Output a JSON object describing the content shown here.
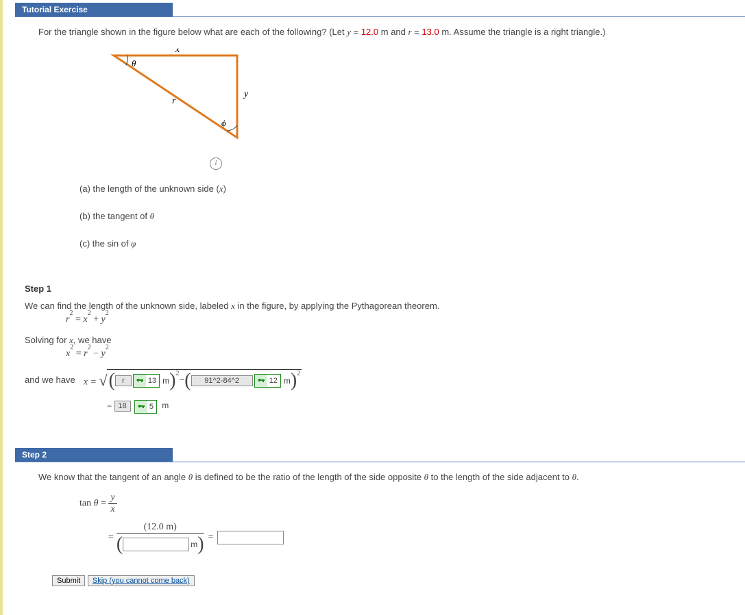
{
  "tutorial": {
    "header": "Tutorial Exercise",
    "prompt_prefix": "For the triangle shown in the figure below what are each of the following? (Let ",
    "prompt_y_var": "y",
    "prompt_y_eq": " = ",
    "prompt_y_val": "12.0",
    "prompt_y_unit": " m and ",
    "prompt_r_var": "r",
    "prompt_r_eq": " = ",
    "prompt_r_val": "13.0",
    "prompt_r_unit": " m. Assume the triangle is a right triangle.)",
    "fig": {
      "x": "x",
      "y": "y",
      "r": "r",
      "theta": "θ",
      "phi": "ϕ"
    },
    "info_icon": "info-icon",
    "parts": {
      "a": "(a) the length of the unknown side (",
      "a_var": "x",
      "a_end": ")",
      "b": "(b) the tangent of ",
      "b_var": "θ",
      "c": "(c) the sin of ",
      "c_var": "φ"
    }
  },
  "step1": {
    "title": "Step 1",
    "line1_pre": "We can find the length of the unknown side, labeled ",
    "line1_var": "x",
    "line1_post": " in the figure, by applying the Pythagorean theorem.",
    "eq1_lhs": "r",
    "eq1_sup": "2",
    "eq1_mid": " = ",
    "eq1_x": "x",
    "eq1_plus": " + ",
    "eq1_y": "y",
    "line2_pre": "Solving for ",
    "line2_var": "x",
    "line2_post": ", we have",
    "eq2_x": "x",
    "eq2_eq": " = ",
    "eq2_r": "r",
    "eq2_minus": " − ",
    "eq2_y": "y",
    "line3": "and we have",
    "x_eq": "x = ",
    "box1_wrong": "r",
    "box1_correct": "13",
    "m": "m",
    "minus": " − ",
    "box2_wrong": "91^2-84^2",
    "box2_correct": "12",
    "eq_final_eq": "= ",
    "box3_wrong": "18",
    "box3_correct": "5"
  },
  "step2": {
    "header": "Step 2",
    "line1_pre": "We know that the tangent of an angle ",
    "line1_th": "θ",
    "line1_mid": " is defined to be the ratio of the length of the side opposite ",
    "line1_post": " to the length of the side adjacent to ",
    "line1_end": ".",
    "tan": "tan ",
    "theta": "θ",
    "eq": " = ",
    "frac_num": "y",
    "frac_den": "x",
    "num_val": "(12.0 m)",
    "m": "m",
    "eq2": " = "
  },
  "actions": {
    "submit": "Submit",
    "skip": "Skip (you cannot come back)"
  }
}
